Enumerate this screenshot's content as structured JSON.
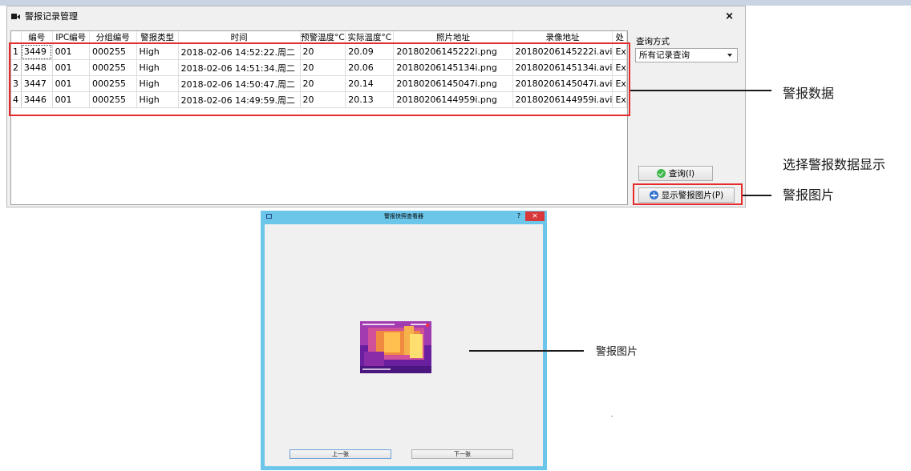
{
  "main_window": {
    "title": "警报记录管理",
    "close_label": "×",
    "table": {
      "headers": [
        "",
        "编号",
        "IPC编号",
        "分组编号",
        "警报类型",
        "时间",
        "预警温度°C",
        "实际温度°C",
        "照片地址",
        "录像地址",
        "处"
      ],
      "rows": [
        {
          "num": "1",
          "id": "3449",
          "ipc": "001",
          "group": "000255",
          "type": "High",
          "time": "2018-02-06 14:52:22.周二",
          "warn_temp": "20",
          "actual_temp": "20.09",
          "photo": "20180206145222i.png",
          "video": "20180206145222i.avi",
          "handle": "Ex"
        },
        {
          "num": "2",
          "id": "3448",
          "ipc": "001",
          "group": "000255",
          "type": "High",
          "time": "2018-02-06 14:51:34.周二",
          "warn_temp": "20",
          "actual_temp": "20.06",
          "photo": "20180206145134i.png",
          "video": "20180206145134i.avi",
          "handle": "Ex"
        },
        {
          "num": "3",
          "id": "3447",
          "ipc": "001",
          "group": "000255",
          "type": "High",
          "time": "2018-02-06 14:50:47.周二",
          "warn_temp": "20",
          "actual_temp": "20.14",
          "photo": "20180206145047i.png",
          "video": "20180206145047i.avi",
          "handle": "Ex"
        },
        {
          "num": "4",
          "id": "3446",
          "ipc": "001",
          "group": "000255",
          "type": "High",
          "time": "2018-02-06 14:49:59.周二",
          "warn_temp": "20",
          "actual_temp": "20.13",
          "photo": "20180206144959i.png",
          "video": "20180206144959i.avi",
          "handle": "Ex"
        }
      ]
    },
    "query_label": "查询方式",
    "query_select_value": "所有记录查询",
    "query_button": "查询(I)",
    "show_image_button": "显示警报图片(P)"
  },
  "annotations": {
    "alarm_data": "警报数据",
    "select_alarm_line1": "选择警报数据显示",
    "select_alarm_line2": "警报图片",
    "alarm_image": "警报图片"
  },
  "viewer": {
    "title": "警报快照查看器",
    "help": "?",
    "close": "×",
    "prev_button": "上一张",
    "next_button": "下一张"
  },
  "colors": {
    "annotation_box": "#e52b2b",
    "dialog_frame": "#6cc6ea",
    "close_button": "#d9383b"
  }
}
